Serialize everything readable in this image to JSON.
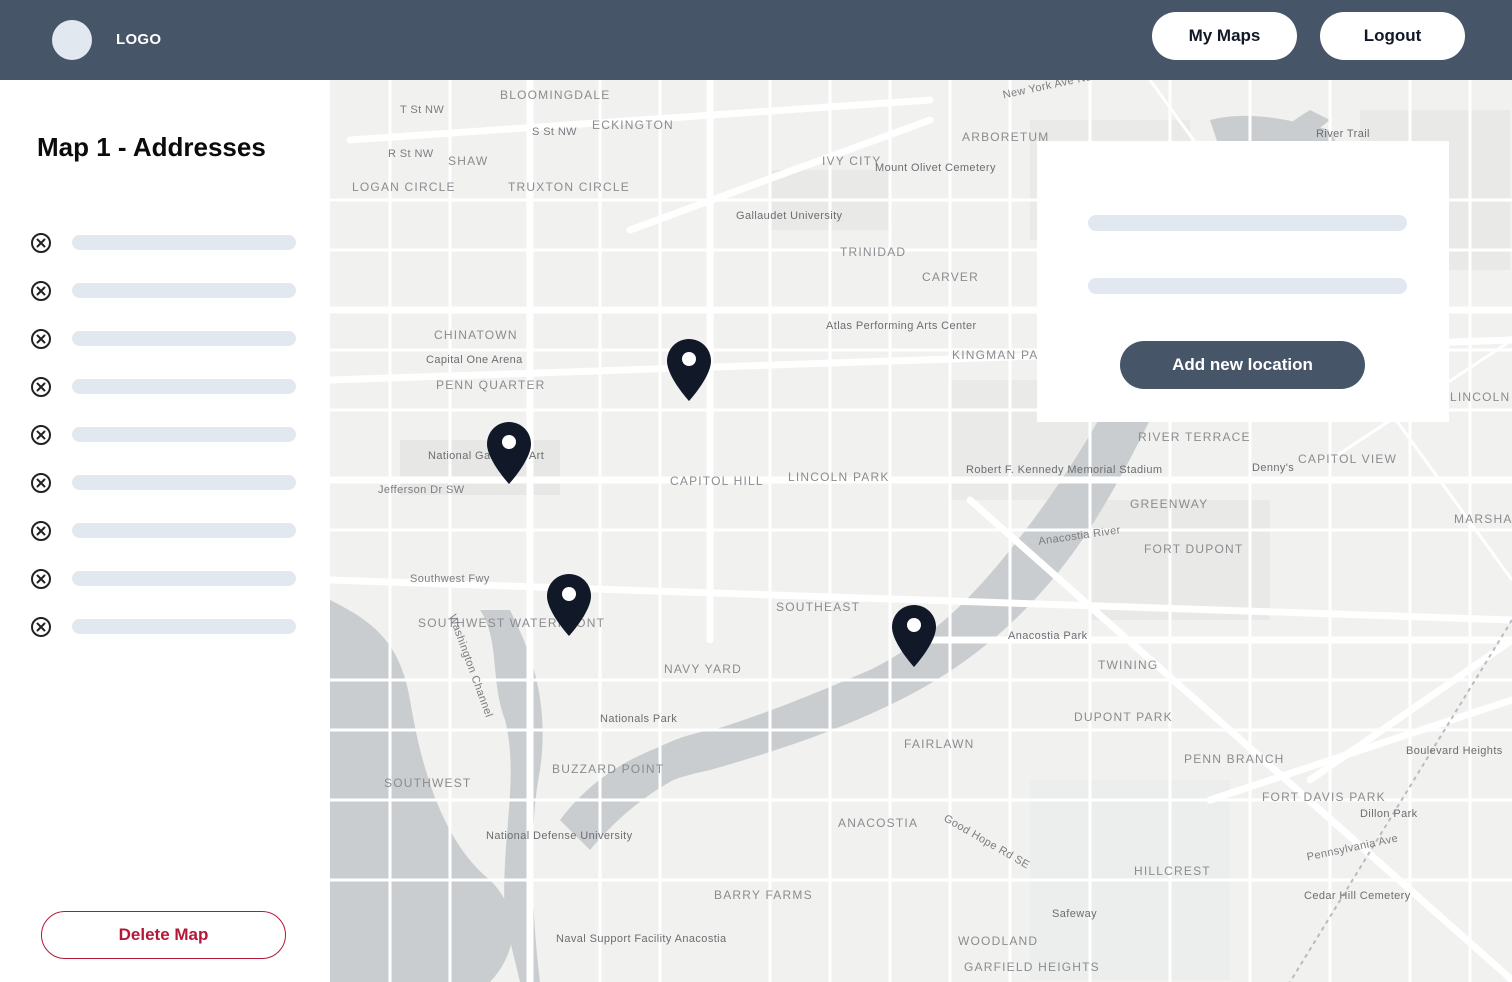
{
  "header": {
    "logo_text": "LOGO",
    "my_maps_label": "My Maps",
    "logout_label": "Logout",
    "bar_color": "#465568"
  },
  "sidebar": {
    "title": "Map 1 - Addresses",
    "addresses": [
      {
        "icon": "remove-circle-icon"
      },
      {
        "icon": "remove-circle-icon"
      },
      {
        "icon": "remove-circle-icon"
      },
      {
        "icon": "remove-circle-icon"
      },
      {
        "icon": "remove-circle-icon"
      },
      {
        "icon": "remove-circle-icon"
      },
      {
        "icon": "remove-circle-icon"
      },
      {
        "icon": "remove-circle-icon"
      },
      {
        "icon": "remove-circle-icon"
      }
    ],
    "delete_label": "Delete Map",
    "delete_color": "#b41838"
  },
  "panel": {
    "add_label": "Add new location"
  },
  "map": {
    "pin_icon": "map-pin-icon",
    "pin_color": "#111827",
    "labels": [
      {
        "text": "BLOOMINGDALE",
        "kind": "big"
      },
      {
        "text": "ECKINGTON",
        "kind": "big"
      },
      {
        "text": "ARBORETUM",
        "kind": "big"
      },
      {
        "text": "New York Ave NE",
        "kind": "street"
      },
      {
        "text": "T St NW",
        "kind": "street"
      },
      {
        "text": "S St NW",
        "kind": "street"
      },
      {
        "text": "R St NW",
        "kind": "street"
      },
      {
        "text": "SHAW",
        "kind": "big"
      },
      {
        "text": "TRUXTON CIRCLE",
        "kind": "big"
      },
      {
        "text": "LOGAN CIRCLE",
        "kind": "big"
      },
      {
        "text": "IVY CITY",
        "kind": "big"
      },
      {
        "text": "Mount Olivet Cemetery",
        "kind": "poi"
      },
      {
        "text": "Gallaudet University",
        "kind": "poi"
      },
      {
        "text": "TRINIDAD",
        "kind": "big"
      },
      {
        "text": "CARVER",
        "kind": "big"
      },
      {
        "text": "CHINATOWN",
        "kind": "big"
      },
      {
        "text": "Capital One Arena",
        "kind": "poi"
      },
      {
        "text": "PENN QUARTER",
        "kind": "big"
      },
      {
        "text": "Atlas Performing Arts Center",
        "kind": "poi"
      },
      {
        "text": "KINGMAN PARK",
        "kind": "big"
      },
      {
        "text": "National Gallery of Art",
        "kind": "poi"
      },
      {
        "text": "Jefferson Dr SW",
        "kind": "street"
      },
      {
        "text": "CAPITOL HILL",
        "kind": "big"
      },
      {
        "text": "LINCOLN PARK",
        "kind": "big"
      },
      {
        "text": "Robert F. Kennedy Memorial Stadium",
        "kind": "poi"
      },
      {
        "text": "RIVER TERRACE",
        "kind": "big"
      },
      {
        "text": "GREENWAY",
        "kind": "big"
      },
      {
        "text": "Anacostia River",
        "kind": "street"
      },
      {
        "text": "Southwest Fwy",
        "kind": "street"
      },
      {
        "text": "SOUTHWEST WATERFRONT",
        "kind": "big"
      },
      {
        "text": "SOUTHEAST",
        "kind": "big"
      },
      {
        "text": "NAVY YARD",
        "kind": "big"
      },
      {
        "text": "Anacostia Park",
        "kind": "poi"
      },
      {
        "text": "FORT DUPONT",
        "kind": "big"
      },
      {
        "text": "TWINING",
        "kind": "big"
      },
      {
        "text": "Nationals Park",
        "kind": "poi"
      },
      {
        "text": "DUPONT PARK",
        "kind": "big"
      },
      {
        "text": "FAIRLAWN",
        "kind": "big"
      },
      {
        "text": "BUZZARD POINT",
        "kind": "big"
      },
      {
        "text": "SOUTHWEST",
        "kind": "big"
      },
      {
        "text": "PENN BRANCH",
        "kind": "big"
      },
      {
        "text": "Boulevard Heights",
        "kind": "poi"
      },
      {
        "text": "ANACOSTIA",
        "kind": "big"
      },
      {
        "text": "FORT DAVIS PARK",
        "kind": "big"
      },
      {
        "text": "Dillon Park",
        "kind": "poi"
      },
      {
        "text": "National Defense University",
        "kind": "poi"
      },
      {
        "text": "HILLCREST",
        "kind": "big"
      },
      {
        "text": "Cedar Hill Cemetery",
        "kind": "poi"
      },
      {
        "text": "BARRY FARMS",
        "kind": "big"
      },
      {
        "text": "Naval Support Facility Anacostia",
        "kind": "poi"
      },
      {
        "text": "WOODLAND",
        "kind": "big"
      },
      {
        "text": "GARFIELD HEIGHTS",
        "kind": "big"
      },
      {
        "text": "Safeway",
        "kind": "poi"
      },
      {
        "text": "Pennsylvania Ave",
        "kind": "street"
      },
      {
        "text": "Denny's",
        "kind": "poi"
      },
      {
        "text": "CAPITOL VIEW",
        "kind": "big"
      },
      {
        "text": "MARSHALL HEIGHTS",
        "kind": "big"
      },
      {
        "text": "LINCOLN HEIGHTS",
        "kind": "big"
      },
      {
        "text": "River Trail",
        "kind": "poi"
      },
      {
        "text": "Good Hope Rd SE",
        "kind": "street"
      },
      {
        "text": "Washington Channel",
        "kind": "street"
      }
    ]
  }
}
